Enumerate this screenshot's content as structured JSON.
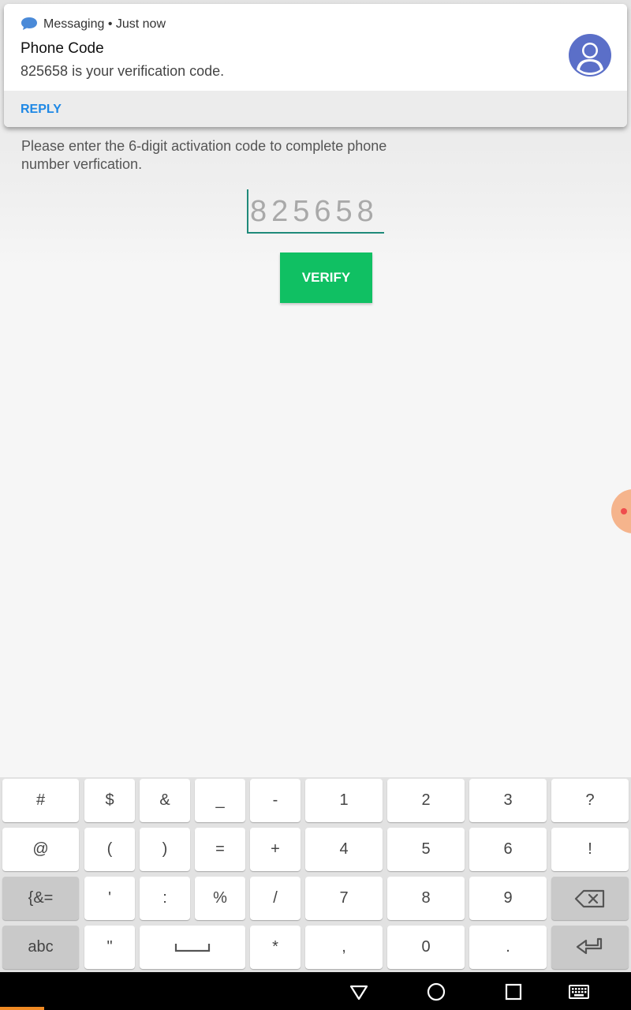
{
  "notification": {
    "app_line": "Messaging • Just now",
    "title": "Phone Code",
    "text": "825658 is your verification code.",
    "reply_label": "REPLY"
  },
  "main": {
    "instruction": "Please enter the 6-digit activation code to complete phone number verfication.",
    "code_value": "825658",
    "verify_label": "VERIFY"
  },
  "keyboard": {
    "row1": [
      "#",
      "$",
      "&",
      "_",
      "-",
      "1",
      "2",
      "3",
      "?"
    ],
    "row2": [
      "@",
      "(",
      ")",
      "=",
      "+",
      "4",
      "5",
      "6",
      "!"
    ],
    "row3": [
      "{&=",
      "'",
      ":",
      "%",
      "/",
      "7",
      "8",
      "9"
    ],
    "row4": [
      "abc",
      "\"",
      "*",
      ",",
      "0",
      "."
    ]
  },
  "colors": {
    "accent_teal": "#1f8a7a",
    "verify_green": "#10c063",
    "reply_blue": "#1e88e5",
    "status_bar": "#153a35"
  },
  "icons": {
    "notification_app": "chat-bubble-icon",
    "avatar": "user-avatar-icon",
    "backspace": "backspace-icon",
    "enter": "enter-icon",
    "space": "space-icon",
    "nav_back": "back-triangle-icon",
    "nav_home": "home-circle-icon",
    "nav_recents": "recents-square-icon",
    "nav_keyboard": "keyboard-icon"
  }
}
